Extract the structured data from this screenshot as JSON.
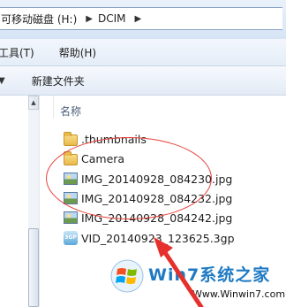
{
  "address_bar": {
    "drive_crumb": "可移动磁盘 (H:)",
    "folder_crumb": "DCIM"
  },
  "menu": {
    "tools": "工具(T)",
    "help": "帮助(H)"
  },
  "toolbar": {
    "new_folder": "新建文件夹"
  },
  "file_list": {
    "column_name": "名称",
    "items": [
      {
        "name": ".thumbnails",
        "type": "folder"
      },
      {
        "name": "Camera",
        "type": "folder"
      },
      {
        "name": "IMG_20140928_084230.jpg",
        "type": "image"
      },
      {
        "name": "IMG_20140928_084232.jpg",
        "type": "image"
      },
      {
        "name": "IMG_20140928_084242.jpg",
        "type": "image"
      },
      {
        "name": "VID_20140923_123625.3gp",
        "type": "video"
      }
    ]
  },
  "annotation": {
    "color": "#e8413a"
  },
  "watermark": {
    "brand": "Win7系统之家",
    "url": "Www.Winwin7.com"
  }
}
